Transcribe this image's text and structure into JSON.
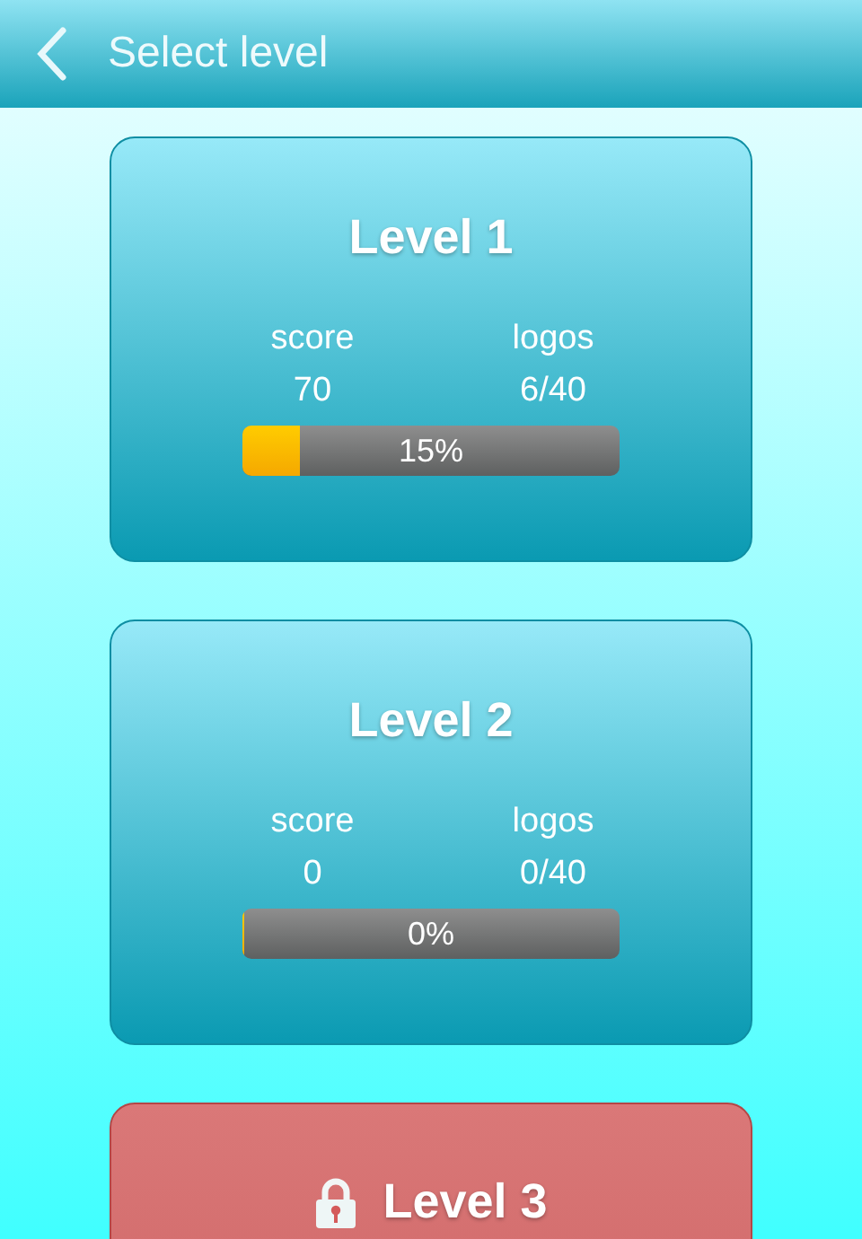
{
  "header": {
    "title": "Select level"
  },
  "levels": [
    {
      "title": "Level 1",
      "locked": false,
      "score_label": "score",
      "score": "70",
      "logos_label": "logos",
      "logos": "6/40",
      "level": 0.15,
      "percent": "15%"
    },
    {
      "title": "Level 2",
      "locked": false,
      "score_label": "score",
      "score": "0",
      "logos_label": "logos",
      "logos": "0/40",
      "level": 0,
      "percent": "0%"
    },
    {
      "title": "Level 3",
      "locked": true
    }
  ]
}
